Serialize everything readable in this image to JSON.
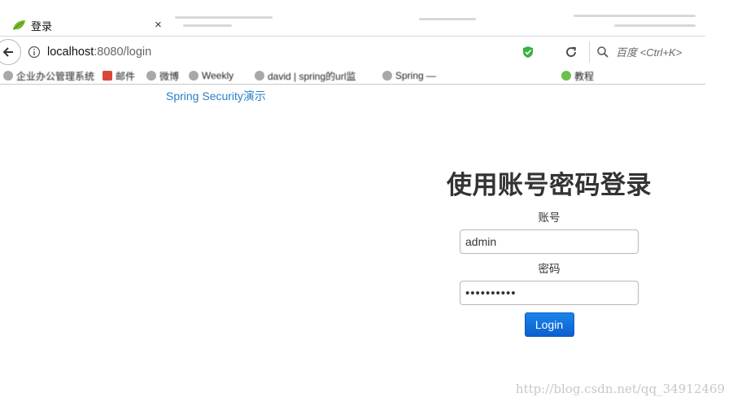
{
  "browser": {
    "tab": {
      "title": "登录",
      "close_glyph": "×"
    },
    "address_bar": {
      "host": "localhost",
      "rest": ":8080/login"
    },
    "search": {
      "placeholder": "百度 <Ctrl+K>"
    },
    "bookmarks": [
      {
        "label": "企业办公管理系统",
        "icon": "globe-icon"
      },
      {
        "label": "邮件",
        "icon": "mail-icon"
      },
      {
        "label": "微博",
        "icon": "globe-icon"
      },
      {
        "label": "Weekly",
        "icon": "globe-icon"
      },
      {
        "label": "david | spring的url监",
        "icon": "globe-icon"
      },
      {
        "label": "Spring — ",
        "icon": "globe-icon"
      },
      {
        "label": "教程",
        "icon": "globe-icon"
      }
    ]
  },
  "page": {
    "header_link": "Spring Security演示",
    "login": {
      "title": "使用账号密码登录",
      "username_label": "账号",
      "username_value": "admin",
      "password_label": "密码",
      "password_value": "••••••••••",
      "submit_label": "Login"
    },
    "watermark": "http://blog.csdn.net/qq_34912469"
  },
  "colors": {
    "link": "#2a7fc7",
    "button": "#0b5fcf",
    "shield": "#3cb043",
    "favicon_leaf": "#7ab82f"
  }
}
